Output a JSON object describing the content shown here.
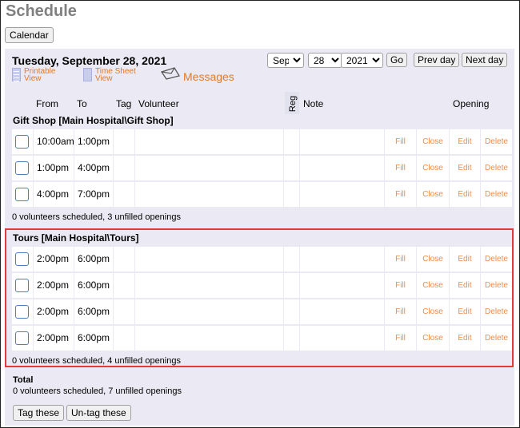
{
  "page": {
    "title": "Schedule",
    "calendar_button": "Calendar"
  },
  "header": {
    "date": "Tuesday, September 28, 2021",
    "printable_view_line1": "Printable",
    "printable_view_line2": "View",
    "timesheet_view_line1": "Time Sheet",
    "timesheet_view_line2": "View",
    "messages": "Messages",
    "month": "Sep",
    "day": "28",
    "year": "2021",
    "go": "Go",
    "prev_day": "Prev day",
    "next_day": "Next day"
  },
  "columns": {
    "from": "From",
    "to": "To",
    "tag": "Tag",
    "volunteer": "Volunteer",
    "reg": "Reg",
    "note": "Note",
    "opening": "Opening"
  },
  "actions": {
    "fill": "Fill",
    "close": "Close",
    "edit": "Edit",
    "delete": "Delete"
  },
  "sections": [
    {
      "name": "Gift Shop [Main Hospital\\Gift Shop]",
      "rows": [
        {
          "from": "10:00am",
          "to": "1:00pm"
        },
        {
          "from": "1:00pm",
          "to": "4:00pm"
        },
        {
          "from": "4:00pm",
          "to": "7:00pm"
        }
      ],
      "summary": "0 volunteers scheduled, 3 unfilled openings"
    },
    {
      "name": "Tours [Main Hospital\\Tours]",
      "rows": [
        {
          "from": "2:00pm",
          "to": "6:00pm"
        },
        {
          "from": "2:00pm",
          "to": "6:00pm"
        },
        {
          "from": "2:00pm",
          "to": "6:00pm"
        },
        {
          "from": "2:00pm",
          "to": "6:00pm"
        }
      ],
      "summary": "0 volunteers scheduled, 4 unfilled openings"
    }
  ],
  "total": {
    "label": "Total",
    "summary": "0 volunteers scheduled, 7 unfilled openings"
  },
  "footer": {
    "tag_these": "Tag these",
    "untag_these": "Un-tag these"
  },
  "colors": {
    "link": "#e07b2b",
    "action": "#f08c4a",
    "highlight": "#e03c3c",
    "panel": "#ebe9f3"
  }
}
